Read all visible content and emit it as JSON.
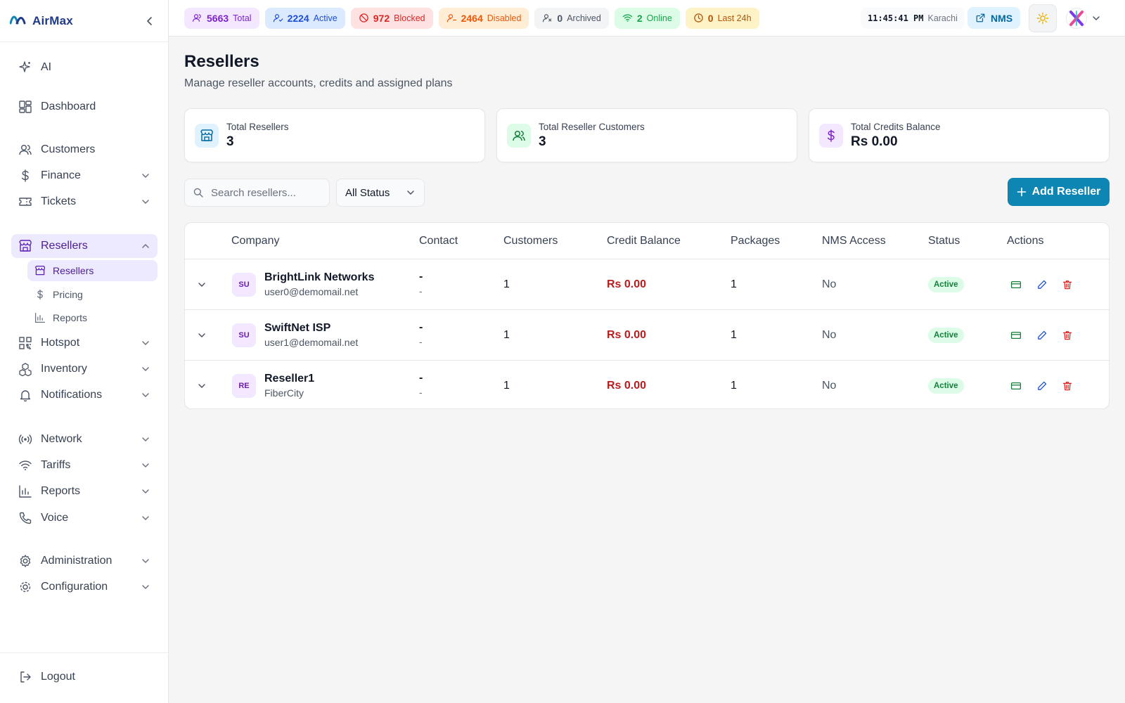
{
  "brand": {
    "name": "AirMax"
  },
  "sidebar": {
    "items": [
      {
        "label": "AI",
        "icon": "sparkles-icon"
      },
      {
        "label": "Dashboard",
        "icon": "dashboard-icon"
      },
      {
        "label": "Customers",
        "icon": "users-icon"
      },
      {
        "label": "Finance",
        "icon": "dollar-icon"
      },
      {
        "label": "Tickets",
        "icon": "ticket-icon"
      },
      {
        "label": "Resellers",
        "icon": "store-icon"
      },
      {
        "label": "Hotspot",
        "icon": "qr-icon"
      },
      {
        "label": "Inventory",
        "icon": "boxes-icon"
      },
      {
        "label": "Notifications",
        "icon": "bell-icon"
      },
      {
        "label": "Network",
        "icon": "radio-icon"
      },
      {
        "label": "Tariffs",
        "icon": "wifi-icon"
      },
      {
        "label": "Reports",
        "icon": "bar-chart-icon"
      },
      {
        "label": "Voice",
        "icon": "phone-icon"
      },
      {
        "label": "Administration",
        "icon": "gear-icon"
      },
      {
        "label": "Configuration",
        "icon": "cog-icon"
      }
    ],
    "subitems": [
      {
        "label": "Resellers",
        "icon": "store-icon"
      },
      {
        "label": "Pricing",
        "icon": "dollar-icon"
      },
      {
        "label": "Reports",
        "icon": "bar-chart-icon"
      }
    ],
    "logout_label": "Logout"
  },
  "topbar": {
    "chips": [
      {
        "count": "5663",
        "label": "Total"
      },
      {
        "count": "2224",
        "label": "Active"
      },
      {
        "count": "972",
        "label": "Blocked"
      },
      {
        "count": "2464",
        "label": "Disabled"
      },
      {
        "count": "0",
        "label": "Archived"
      },
      {
        "count": "2",
        "label": "Online"
      },
      {
        "count": "0",
        "label": "Last 24h"
      }
    ],
    "time": "11:45:41 PM",
    "timezone": "Karachi",
    "nms_label": "NMS"
  },
  "page": {
    "title": "Resellers",
    "subtitle": "Manage reseller accounts, credits and assigned plans"
  },
  "stats": [
    {
      "label": "Total Resellers",
      "value": "3"
    },
    {
      "label": "Total Reseller Customers",
      "value": "3"
    },
    {
      "label": "Total Credits Balance",
      "value": "Rs 0.00"
    }
  ],
  "filters": {
    "search_placeholder": "Search resellers...",
    "status_value": "All Status"
  },
  "add_button_label": "Add Reseller",
  "table": {
    "headers": [
      "Company",
      "Contact",
      "Customers",
      "Credit Balance",
      "Packages",
      "NMS Access",
      "Status",
      "Actions"
    ],
    "rows": [
      {
        "initials": "SU",
        "company": "BrightLink Networks",
        "sub": "user0@demomail.net",
        "contact1": "-",
        "contact2": "-",
        "customers": "1",
        "credit": "Rs 0.00",
        "packages": "1",
        "nms": "No",
        "status": "Active"
      },
      {
        "initials": "SU",
        "company": "SwiftNet ISP",
        "sub": "user1@demomail.net",
        "contact1": "-",
        "contact2": "-",
        "customers": "1",
        "credit": "Rs 0.00",
        "packages": "1",
        "nms": "No",
        "status": "Active"
      },
      {
        "initials": "RE",
        "company": "Reseller1",
        "sub": "FiberCity",
        "contact1": "-",
        "contact2": "-",
        "customers": "1",
        "credit": "Rs 0.00",
        "packages": "1",
        "nms": "No",
        "status": "Active"
      }
    ]
  },
  "colors": {
    "accent": "#0e86b4",
    "active_nav_bg": "#ede9fe",
    "credit_red": "#b91c1c",
    "status_green": "#15803d"
  }
}
